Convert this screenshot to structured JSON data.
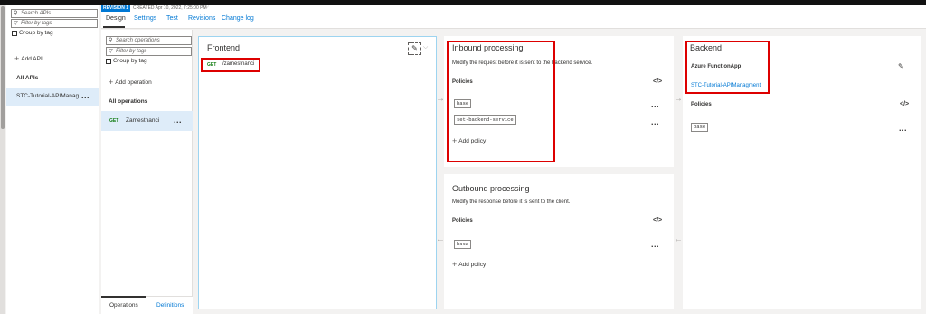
{
  "left_pane": {
    "search_placeholder": "Search APIs",
    "filter_placeholder": "Filter by tags",
    "group_by_tag": "Group by tag",
    "add_api": "Add API",
    "all_apis": "All APIs",
    "api_item": "STC-Tutorial-APIManag..."
  },
  "revision": {
    "badge": "REVISION 1",
    "created": "CREATED Apr 10, 2022, 7:25:00 PM"
  },
  "tabs": [
    "Design",
    "Settings",
    "Test",
    "Revisions",
    "Change log"
  ],
  "ops_pane": {
    "search_placeholder": "Search operations",
    "filter_placeholder": "Filter by tags",
    "group_by_tag": "Group by tag",
    "add_operation": "Add operation",
    "all_operations": "All operations",
    "operation": {
      "method": "GET",
      "name": "Zamestnanci"
    },
    "bottom_tabs": [
      "Operations",
      "Definitions"
    ]
  },
  "frontend": {
    "title": "Frontend",
    "method": "GET",
    "path": "/zamestnanci"
  },
  "inbound": {
    "title": "Inbound processing",
    "description": "Modify the request before it is sent to the backend service.",
    "policies_label": "Policies",
    "policies": [
      "base",
      "set-backend-service"
    ],
    "add_policy": "Add policy"
  },
  "outbound": {
    "title": "Outbound processing",
    "description": "Modify the response before it is sent to the client.",
    "policies_label": "Policies",
    "policies": [
      "base"
    ],
    "add_policy": "Add policy"
  },
  "backend": {
    "title": "Backend",
    "type": "Azure FunctionApp",
    "link": "STC-Tutorial-APIManagment",
    "policies_label": "Policies",
    "policies": [
      "base"
    ]
  },
  "icons": {
    "code": "</>",
    "more": "...",
    "pencil": "✎",
    "arrow_right": "→",
    "arrow_left": "←",
    "plus": "+",
    "search": "⚲",
    "filter": "▽"
  },
  "colors": {
    "accent": "#0078d4",
    "get_method": "#107c10",
    "highlight_box": "#dd0000"
  }
}
